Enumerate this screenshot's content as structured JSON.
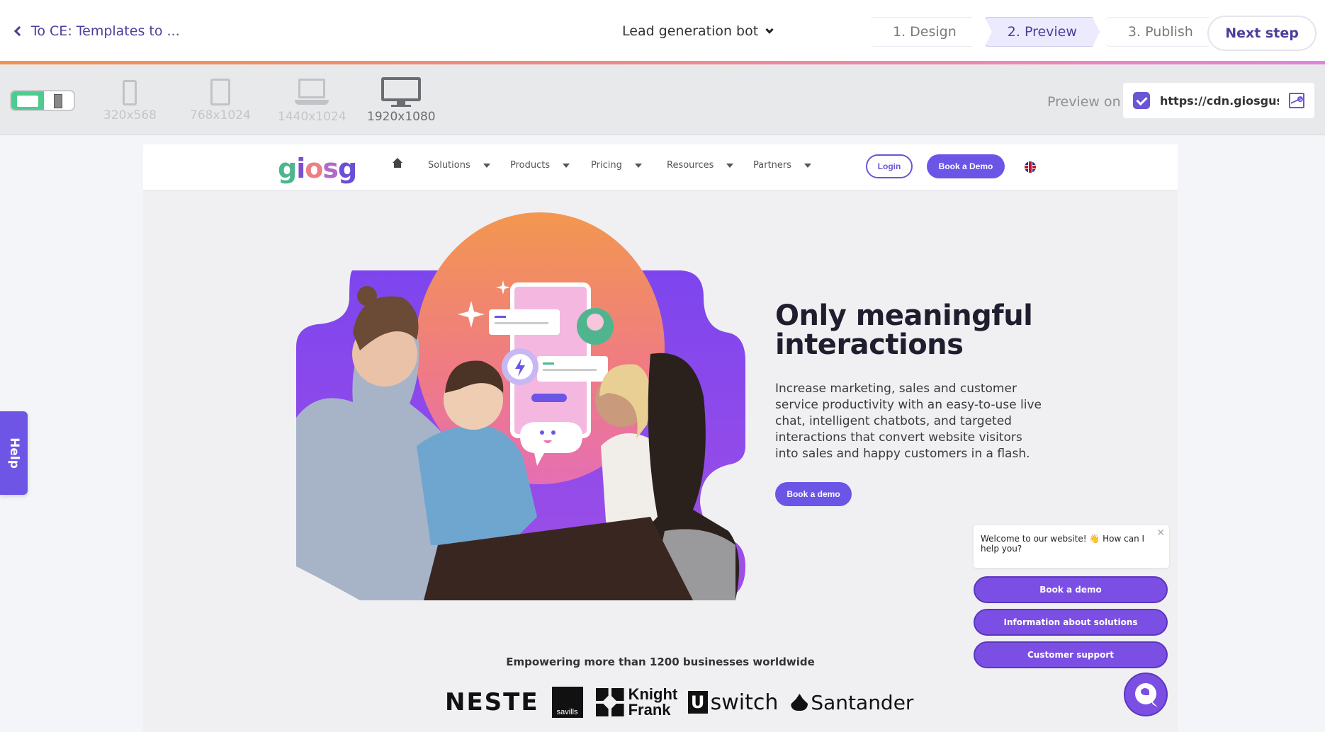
{
  "header": {
    "back_label": "To CE: Templates to ...",
    "bot_select": "Lead generation bot",
    "steps": [
      {
        "label": "1. Design",
        "active": false
      },
      {
        "label": "2. Preview",
        "active": true
      },
      {
        "label": "3. Publish",
        "active": false
      }
    ],
    "next_label": "Next step"
  },
  "toolbar": {
    "devices": [
      {
        "label": "320x568",
        "icon": "phone-icon",
        "active": false
      },
      {
        "label": "768x1024",
        "icon": "tablet-icon",
        "active": false
      },
      {
        "label": "1440x1024",
        "icon": "laptop-icon",
        "active": false
      },
      {
        "label": "1920x1080",
        "icon": "desktop-icon",
        "active": true
      }
    ],
    "preview_on_label": "Preview on",
    "preview_url": "https://cdn.giosguse...",
    "preview_checked": true
  },
  "site": {
    "logo": [
      "g",
      "i",
      "o",
      "s",
      "g"
    ],
    "nav": [
      "Solutions",
      "Products",
      "Pricing",
      "Resources",
      "Partners"
    ],
    "login_label": "Login",
    "demo_label": "Book a Demo",
    "hero": {
      "title_line1": "Only meaningful",
      "title_line2": "interactions",
      "body": "Increase marketing, sales and customer service productivity with an easy-to-use live chat, intelligent chatbots, and targeted interactions that convert website visitors into sales and happy customers in a flash.",
      "cta": "Book a demo"
    },
    "empower_text": "Empowering more than 1200 businesses worldwide",
    "client_logos": [
      "NESTE",
      "savills",
      "Knight Frank",
      "switch",
      "Santander"
    ]
  },
  "chat": {
    "welcome": "Welcome to our website! 👋 How can I help you?",
    "options": [
      "Book a demo",
      "Information about solutions",
      "Customer support"
    ]
  },
  "help_label": "Help",
  "colors": {
    "brand_purple": "#6a55e6",
    "header_accent": "#4b3f9c",
    "toggle_green": "#4ecb8f"
  }
}
